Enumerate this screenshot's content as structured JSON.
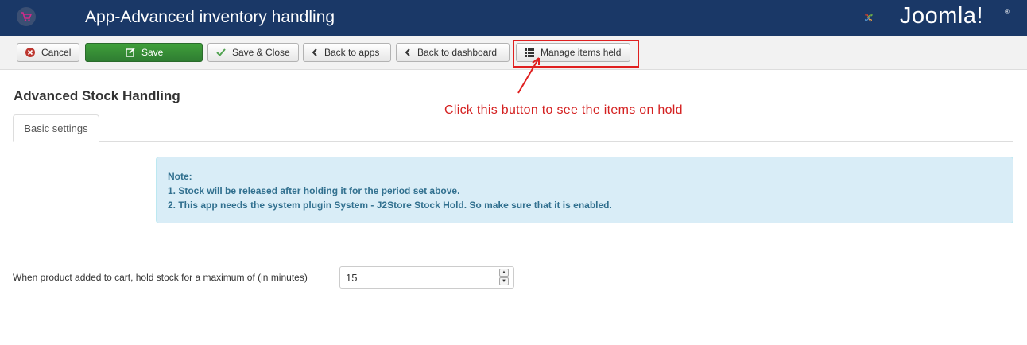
{
  "header": {
    "title": "App-Advanced inventory handling",
    "app_icon": "shopping-cart-icon",
    "logo_text": "Joomla!",
    "logo_reg": "®",
    "background": "#1a3867"
  },
  "toolbar": {
    "cancel_label": "Cancel",
    "save_label": "Save",
    "save_close_label": "Save & Close",
    "back_to_apps_label": "Back to apps",
    "back_to_dashboard_label": "Back to dashboard",
    "manage_items_label": "Manage items held",
    "save_color": "#3f9f3a"
  },
  "annotation": {
    "text": "Click this button to see the items on hold",
    "color": "#d42020"
  },
  "page": {
    "heading": "Advanced Stock Handling",
    "tabs": [
      {
        "label": "Basic settings"
      }
    ]
  },
  "note": {
    "title": "Note:",
    "line1": "1. Stock will be released after holding it for the period set above.",
    "line2": "2. This app needs the system plugin System - J2Store Stock Hold. So make sure that it is enabled."
  },
  "hold_field": {
    "label": "When product added to cart, hold stock for a maximum of (in minutes)",
    "value": "15"
  }
}
